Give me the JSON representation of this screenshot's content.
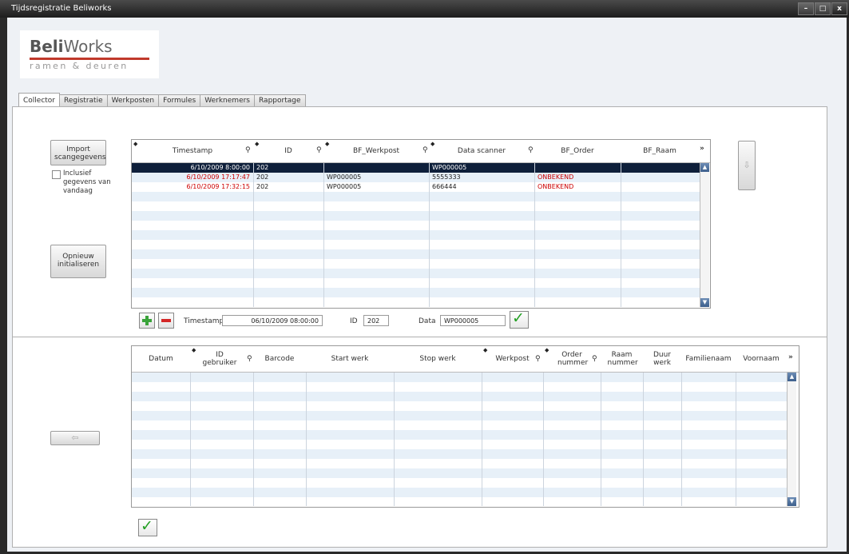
{
  "window": {
    "title": "Tijdsregistratie Beliworks",
    "minimize": "–",
    "maximize": "□",
    "close": "x"
  },
  "logo": {
    "brand_bold": "Beli",
    "brand_rest": "Works",
    "tagline": "ramen & deuren"
  },
  "tabs": [
    "Collector",
    "Registratie",
    "Werkposten",
    "Formules",
    "Werknemers",
    "Rapportage"
  ],
  "active_tab": "Collector",
  "collector": {
    "import_button": "Import scangegevens",
    "include_checkbox_label": "Inclusief gegevens van vandaag",
    "include_checked": false,
    "reset_button": "Opnieuw initialiseren",
    "columns": [
      "Timestamp",
      "ID",
      "BF_Werkpost",
      "Data scanner",
      "BF_Order",
      "BF_Raam"
    ],
    "rows": [
      {
        "timestamp": "6/10/2009 8:00:00",
        "id": "202",
        "werkpost": "",
        "data": "WP000005",
        "order": "",
        "raam": "",
        "selected": true
      },
      {
        "timestamp": "6/10/2009 17:17:47",
        "id": "202",
        "werkpost": "WP000005",
        "data": "5555333",
        "order": "ONBEKEND",
        "raam": "",
        "selected": false
      },
      {
        "timestamp": "6/10/2009 17:32:15",
        "id": "202",
        "werkpost": "WP000005",
        "data": "666444",
        "order": "ONBEKEND",
        "raam": "",
        "selected": false
      }
    ],
    "editor": {
      "timestamp_label": "Timestamp",
      "timestamp_value": "06/10/2009 08:00:00",
      "id_label": "ID",
      "id_value": "202",
      "data_label": "Data",
      "data_value": "WP000005"
    },
    "down_arrow": "⇩"
  },
  "registratie": {
    "left_arrow": "⇦",
    "columns": [
      "Datum",
      "ID gebruiker",
      "Barcode",
      "Start werk",
      "Stop werk",
      "Werkpost",
      "Order nummer",
      "Raam nummer",
      "Duur werk",
      "Familienaam",
      "Voornaam"
    ]
  },
  "colors": {
    "accent_red": "#cc0000",
    "selected_row": "#0e1f3a",
    "stripe": "#e7f0f8"
  }
}
